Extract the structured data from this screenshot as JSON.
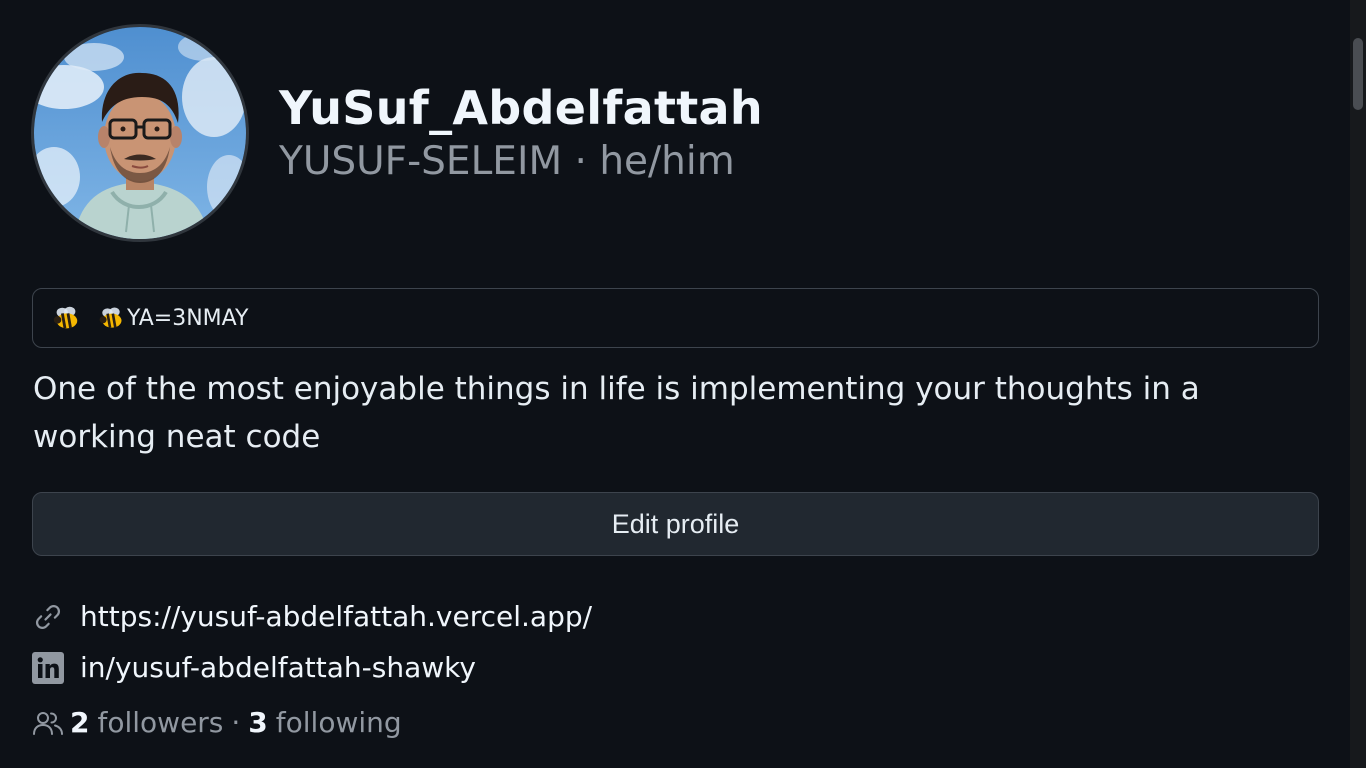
{
  "profile": {
    "display_name": "YuSuf_Abdelfattah",
    "username": "YUSUF-SELEIM",
    "separator": "·",
    "pronouns": "he/him",
    "avatar_alt": "Profile photo"
  },
  "status": {
    "emoji_icon": "bee-icon",
    "text": "YA=3NMAY"
  },
  "bio": "One of the most enjoyable things in life is implementing your thoughts in a working neat code",
  "actions": {
    "edit_profile_label": "Edit profile"
  },
  "links": {
    "website": {
      "icon": "link-icon",
      "text": "https://yusuf-abdelfattah.vercel.app/"
    },
    "linkedin": {
      "icon": "linkedin-icon",
      "text": "in/yusuf-abdelfattah-shawky"
    }
  },
  "social": {
    "icon": "people-icon",
    "followers_count": "2",
    "followers_label": "followers",
    "separator": "·",
    "following_count": "3",
    "following_label": "following"
  },
  "colors": {
    "background": "#0d1117",
    "text_primary": "#f0f6fc",
    "text_muted": "#9198a1",
    "border": "#3d444d",
    "button_bg": "#212830"
  }
}
